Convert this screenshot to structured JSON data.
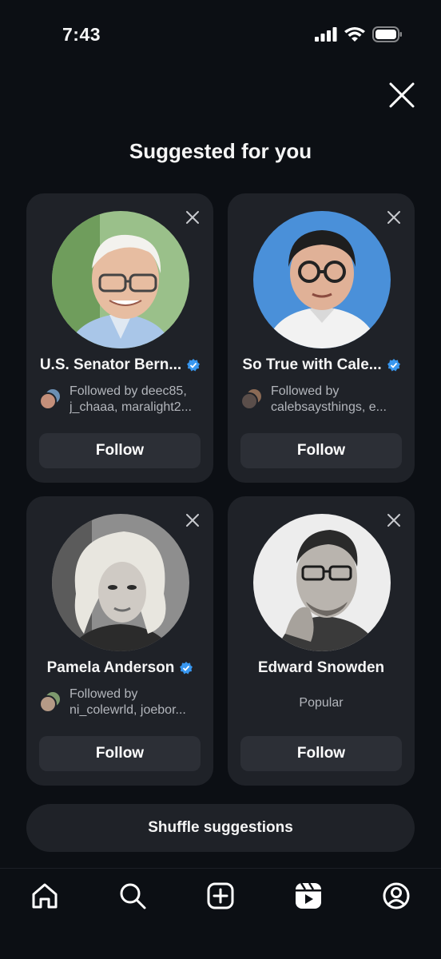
{
  "status_bar": {
    "time": "7:43"
  },
  "header": {
    "title": "Suggested for you"
  },
  "cards": [
    {
      "name": "U.S. Senator Bern...",
      "verified": true,
      "followed_by_line1": "Followed by deec85,",
      "followed_by_line2": "j_chaaa, maralight2...",
      "follow_label": "Follow"
    },
    {
      "name": "So True with Cale...",
      "verified": true,
      "followed_by_line1": "Followed by",
      "followed_by_line2": "calebsaysthings, e...",
      "follow_label": "Follow"
    },
    {
      "name": "Pamela Anderson",
      "verified": true,
      "followed_by_line1": "Followed by",
      "followed_by_line2": "ni_colewrld, joebor...",
      "follow_label": "Follow"
    },
    {
      "name": "Edward Snowden",
      "verified": false,
      "subtitle": "Popular",
      "follow_label": "Follow"
    }
  ],
  "shuffle_label": "Shuffle suggestions",
  "tabs": [
    "home-icon",
    "search-icon",
    "create-icon",
    "reels-icon",
    "profile-icon"
  ],
  "colors": {
    "background": "#0c0f14",
    "card": "#1f2228",
    "button": "#2c2f36",
    "verified": "#3897f0"
  }
}
